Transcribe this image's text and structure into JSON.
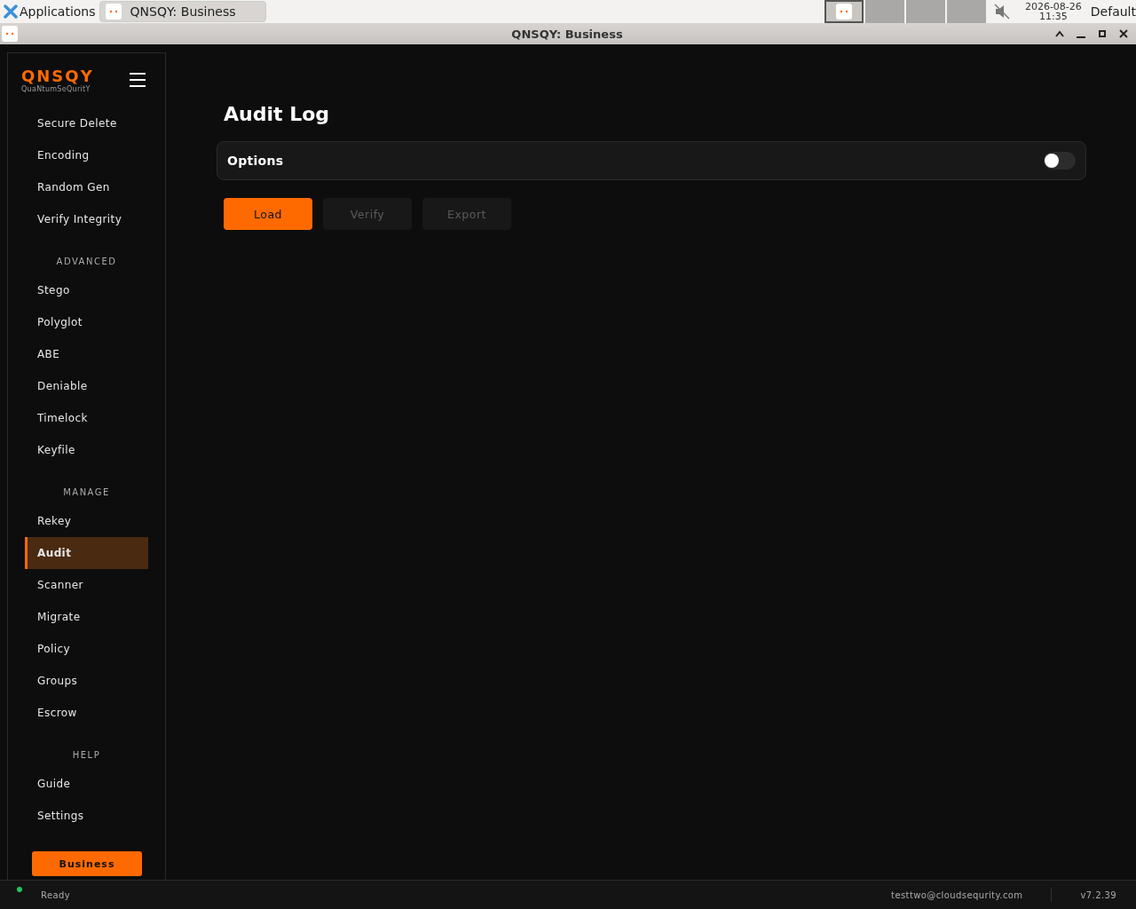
{
  "taskbar": {
    "menu": "Applications",
    "tasks": [
      {
        "label": "QNSQY: Business",
        "selected": true
      }
    ],
    "clock_date": "2026-08-26",
    "clock_time": "11:35",
    "muted": true,
    "layout": "Default"
  },
  "window": {
    "title": "QNSQY: Business"
  },
  "sidebar": {
    "logo": "QNSQY",
    "tagline": "QuaNtumSeQuritY",
    "sections": [
      {
        "items": [
          {
            "label": "Secure Delete",
            "selected": false
          },
          {
            "label": "Encoding",
            "selected": false
          },
          {
            "label": "Random Gen",
            "selected": false
          },
          {
            "label": "Verify Integrity",
            "selected": false
          }
        ]
      },
      {
        "heading": "ADVANCED",
        "items": [
          {
            "label": "Stego",
            "selected": false
          },
          {
            "label": "Polyglot",
            "selected": false
          },
          {
            "label": "ABE",
            "selected": false
          },
          {
            "label": "Deniable",
            "selected": false
          },
          {
            "label": "Timelock",
            "selected": false
          },
          {
            "label": "Keyfile",
            "selected": false
          }
        ]
      },
      {
        "heading": "MANAGE",
        "items": [
          {
            "label": "Rekey",
            "selected": false
          },
          {
            "label": "Audit",
            "selected": true
          },
          {
            "label": "Scanner",
            "selected": false
          },
          {
            "label": "Migrate",
            "selected": false
          },
          {
            "label": "Policy",
            "selected": false
          },
          {
            "label": "Groups",
            "selected": false
          },
          {
            "label": "Escrow",
            "selected": false
          }
        ]
      },
      {
        "heading": "HELP",
        "items": [
          {
            "label": "Guide",
            "selected": false
          },
          {
            "label": "Settings",
            "selected": false
          }
        ]
      }
    ],
    "tier": "Business"
  },
  "main": {
    "title": "Audit Log",
    "options": {
      "label": "Options",
      "on": false
    },
    "buttons": [
      {
        "label": "Load",
        "disabled": false
      },
      {
        "label": "Verify",
        "disabled": true
      },
      {
        "label": "Export",
        "disabled": true
      }
    ]
  },
  "status_bar": {
    "status": "Ready",
    "color": "#22c55e",
    "user": "testtwo@cloudsequrity.com",
    "version": "v7.2.39"
  }
}
